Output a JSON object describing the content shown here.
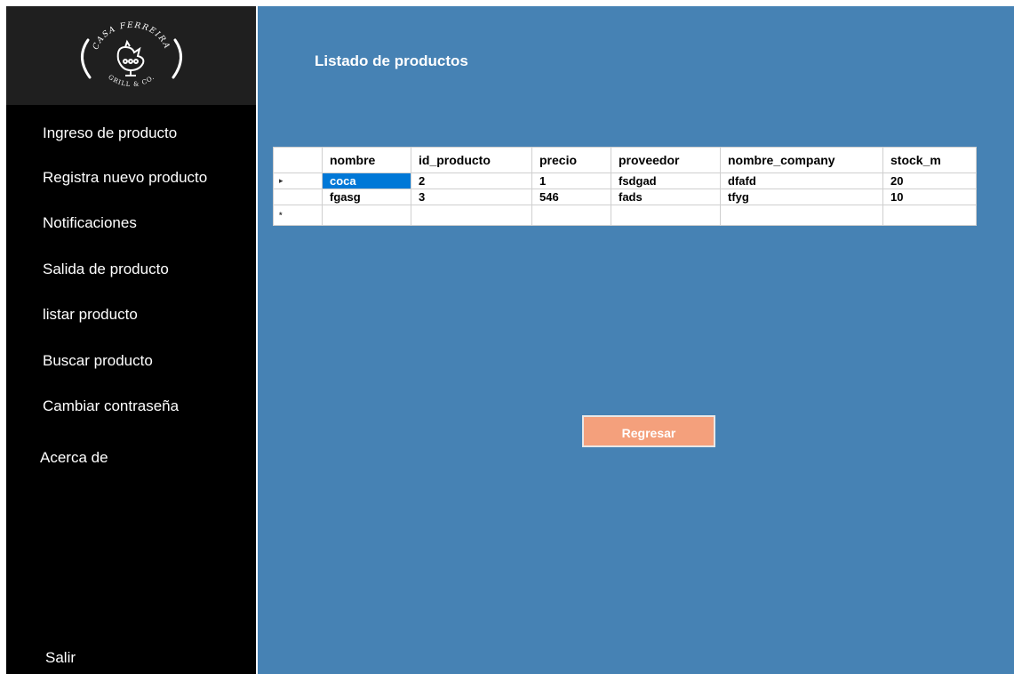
{
  "brand": {
    "logo_text_top": "CASA FERREIRA",
    "logo_text_bottom": "GRILL & CO."
  },
  "sidebar": {
    "items": [
      {
        "label": "Ingreso de producto"
      },
      {
        "label": "Registra nuevo producto"
      },
      {
        "label": "Notificaciones"
      },
      {
        "label": "Salida de producto"
      },
      {
        "label": "listar producto"
      },
      {
        "label": "Buscar producto"
      },
      {
        "label": "Cambiar contraseña"
      },
      {
        "label": "Acerca de"
      }
    ],
    "exit_label": "Salir"
  },
  "main": {
    "title": "Listado de productos",
    "back_button": "Regresar"
  },
  "table": {
    "columns": [
      "nombre",
      "id_producto",
      "precio",
      "proveedor",
      "nombre_company",
      "stock_m"
    ],
    "rows": [
      [
        "coca",
        "2",
        "1",
        "fsdgad",
        "dfafd",
        "20"
      ],
      [
        "fgasg",
        "3",
        "546",
        "fads",
        "tfyg",
        "10"
      ]
    ],
    "current_row_marker": "▸",
    "new_row_marker": "*"
  },
  "colors": {
    "sidebar_bg": "#000000",
    "logo_bg": "#1f1f1f",
    "main_bg": "#4682b4",
    "button_bg": "#f4a07c",
    "selection": "#0078d7"
  }
}
